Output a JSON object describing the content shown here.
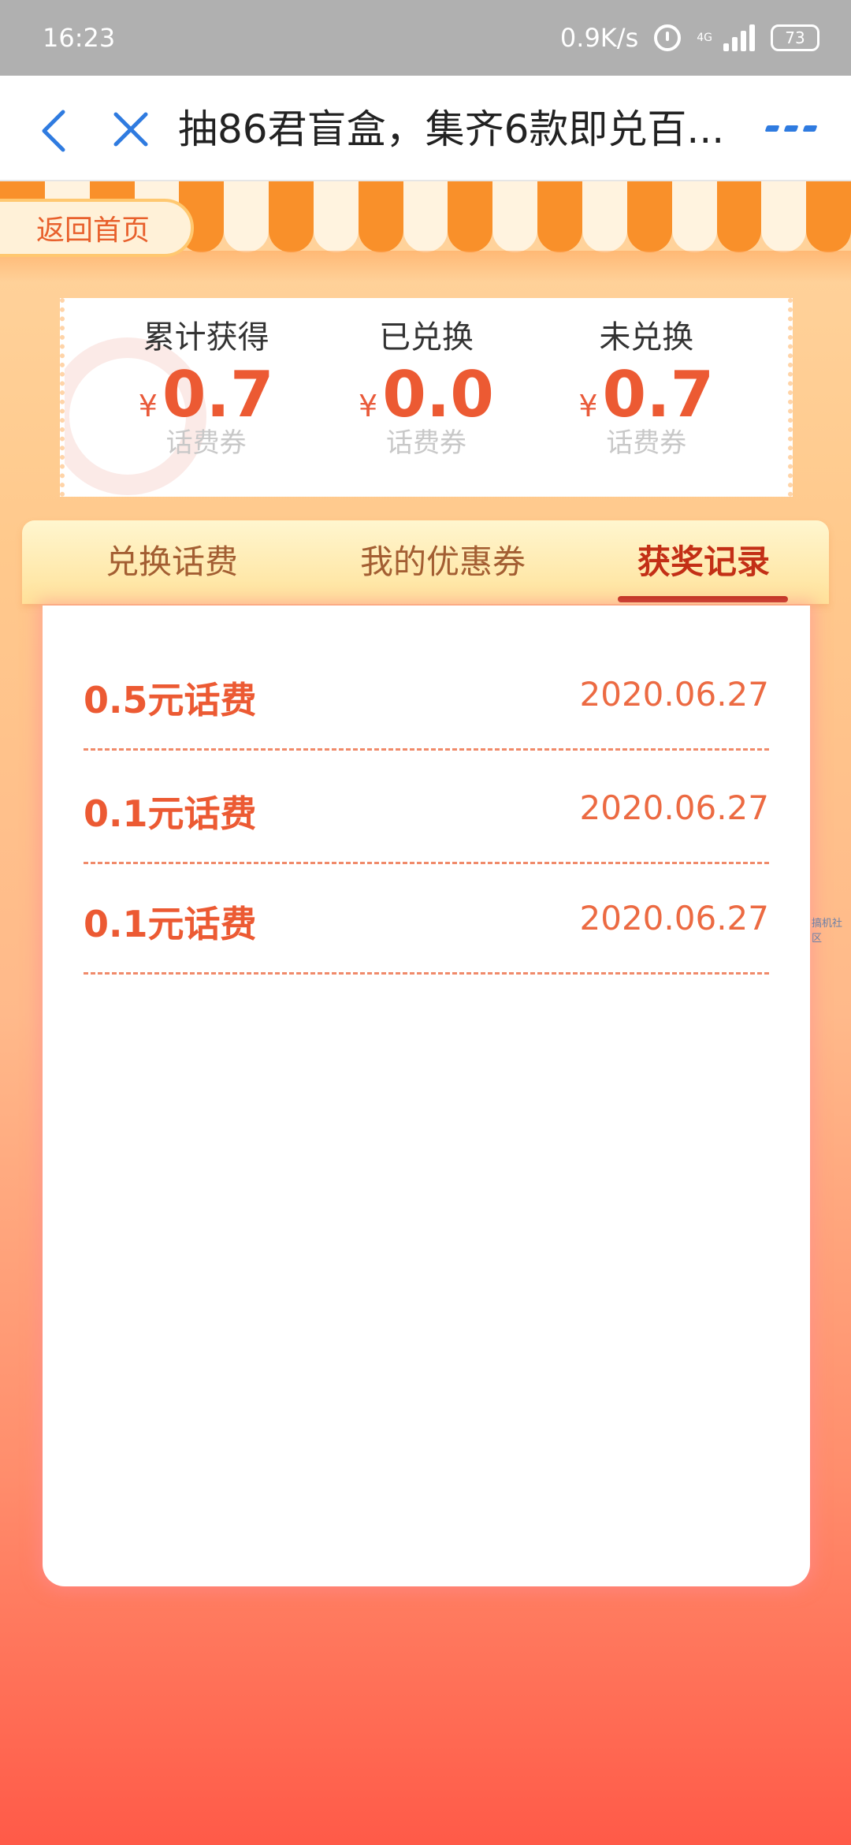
{
  "status_bar": {
    "time": "16:23",
    "speed": "0.9K/s",
    "network": "4G",
    "battery": "73",
    "icons": [
      "alarm-icon",
      "signal-icon",
      "battery-icon"
    ]
  },
  "title_bar": {
    "title": "抽86君盲盒，集齐6款即兑百...",
    "icons": [
      "back-arrow-icon",
      "close-icon",
      "more-icon"
    ],
    "accent_color": "#2f7be0"
  },
  "home_button": {
    "label": "返回首页"
  },
  "stats": [
    {
      "label": "累计获得",
      "currency": "¥",
      "value": "0.7",
      "unit": "话费券"
    },
    {
      "label": "已兑换",
      "currency": "¥",
      "value": "0.0",
      "unit": "话费券"
    },
    {
      "label": "未兑换",
      "currency": "¥",
      "value": "0.7",
      "unit": "话费券"
    }
  ],
  "tabs": [
    {
      "label": "兑换话费",
      "active": false
    },
    {
      "label": "我的优惠券",
      "active": false
    },
    {
      "label": "获奖记录",
      "active": true
    }
  ],
  "records": [
    {
      "title": "0.5元话费",
      "date": "2020.06.27"
    },
    {
      "title": "0.1元话费",
      "date": "2020.06.27"
    },
    {
      "title": "0.1元话费",
      "date": "2020.06.27"
    }
  ],
  "side_tag": "搞机社区",
  "colors": {
    "primary": "#ec5a33",
    "tab_active": "#c32f16",
    "tab_inactive": "#a35e32",
    "awning_orange": "#f9902a",
    "awning_cream": "#fff3df"
  }
}
